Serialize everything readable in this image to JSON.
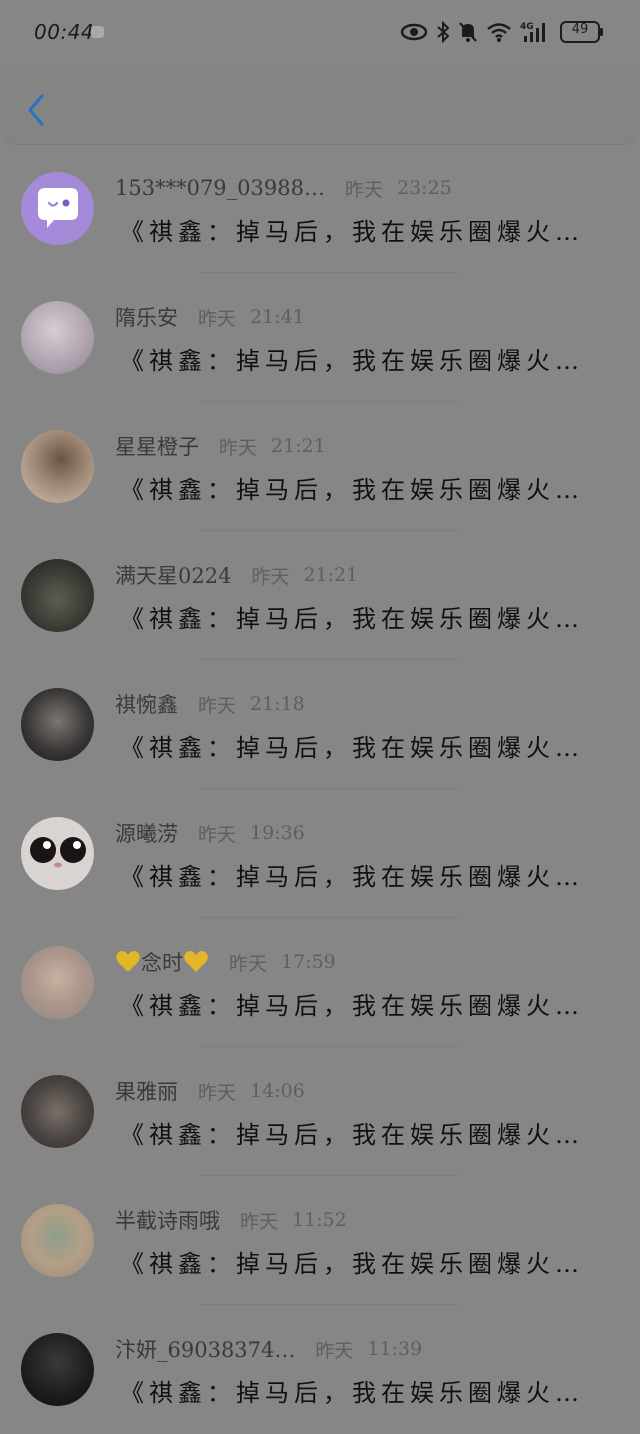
{
  "status_bar": {
    "time": "00:44",
    "battery": "49",
    "network": "4G"
  },
  "colors": {
    "back_arrow": "#2a73c2",
    "message_text": "#111111",
    "avatar_purple": "#a48ad8",
    "heart_gold": "#e3b628"
  },
  "header": {
    "back_icon": "chevron-left-icon"
  },
  "rows": [
    {
      "name": "153***079_03988…",
      "date": "昨天",
      "time": "23:25",
      "message": "《祺鑫：掉马后，我在娱乐圈爆火…"
    },
    {
      "name": "隋乐安",
      "date": "昨天",
      "time": "21:41",
      "message": "《祺鑫：掉马后，我在娱乐圈爆火…"
    },
    {
      "name": "星星橙子",
      "date": "昨天",
      "time": "21:21",
      "message": "《祺鑫：掉马后，我在娱乐圈爆火…"
    },
    {
      "name": "满天星0224",
      "date": "昨天",
      "time": "21:21",
      "message": "《祺鑫：掉马后，我在娱乐圈爆火…"
    },
    {
      "name": "祺惋鑫",
      "date": "昨天",
      "time": "21:18",
      "message": "《祺鑫：掉马后，我在娱乐圈爆火…"
    },
    {
      "name": "源曦涝",
      "date": "昨天",
      "time": "19:36",
      "message": "《祺鑫：掉马后，我在娱乐圈爆火…"
    },
    {
      "name": "念时",
      "date": "昨天",
      "time": "17:59",
      "message": "《祺鑫：掉马后，我在娱乐圈爆火…"
    },
    {
      "name": "果雅丽",
      "date": "昨天",
      "time": "14:06",
      "message": "《祺鑫：掉马后，我在娱乐圈爆火…"
    },
    {
      "name": "半截诗雨哦",
      "date": "昨天",
      "time": "11:52",
      "message": "《祺鑫：掉马后，我在娱乐圈爆火…"
    },
    {
      "name": "汴妍_69038374…",
      "date": "昨天",
      "time": "11:39",
      "message": "《祺鑫：掉马后，我在娱乐圈爆火…"
    }
  ]
}
